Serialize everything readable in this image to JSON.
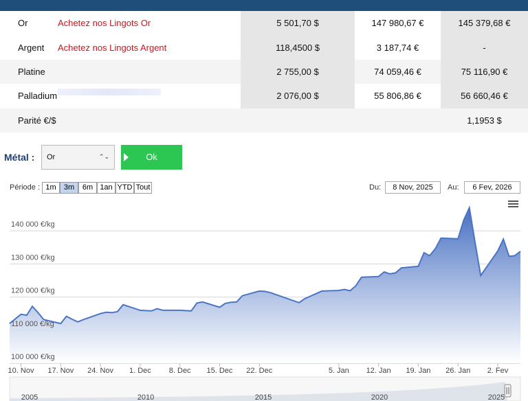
{
  "table": {
    "rows": [
      {
        "metal": "Or",
        "buy": "Achetez nos Lingots Or",
        "usd": "5 501,70 $",
        "eur_kg": "147 980,67 €",
        "eur_kg2": "145 379,68 €"
      },
      {
        "metal": "Argent",
        "buy": "Achetez nos Lingots Argent",
        "usd": "118,4500 $",
        "eur_kg": "3 187,74 €",
        "eur_kg2": "-"
      },
      {
        "metal": "Platine",
        "buy": "",
        "usd": "2 755,00 $",
        "eur_kg": "74 059,46 €",
        "eur_kg2": "75 116,90 €"
      },
      {
        "metal": "Palladium",
        "buy": "",
        "usd": "2 076,00 $",
        "eur_kg": "55 806,86 €",
        "eur_kg2": "56 660,46 €"
      }
    ],
    "parity_label": "Parité €/$",
    "parity_value": "1,1953 $"
  },
  "controls": {
    "metal_label": "Métal :",
    "metal_selected": "Or",
    "ok_label": "Ok",
    "period_label": "Période :",
    "periods": [
      "1m",
      "3m",
      "6m",
      "1an",
      "YTD",
      "Tout"
    ],
    "period_selected": "3m",
    "from_label": "Du:",
    "from_value": "8 Nov, 2025",
    "to_label": "Au:",
    "to_value": "6 Fev, 2026"
  },
  "colors": {
    "header": "#1f4e7a",
    "buy_link": "#d0121b",
    "ok": "#2cc653",
    "series": "#4a74c4",
    "metal_label": "#1f3f78"
  },
  "chart_data": {
    "type": "area",
    "ylim": [
      100000,
      150000
    ],
    "y_ticks": [
      100000,
      110000,
      120000,
      130000,
      140000
    ],
    "y_tick_labels": [
      "100 000 €/kg",
      "110 000 €/kg",
      "120 000 €/kg",
      "130 000 €/kg",
      "140 000 €/kg"
    ],
    "x_range": [
      "2025-11-08",
      "2026-02-06"
    ],
    "x_ticks": [
      "2025-11-10",
      "2025-11-17",
      "2025-11-24",
      "2025-12-01",
      "2025-12-08",
      "2025-12-15",
      "2025-12-22",
      "2026-01-05",
      "2026-01-12",
      "2026-01-19",
      "2026-01-26",
      "2026-02-02"
    ],
    "x_tick_labels": [
      "10. Nov",
      "17. Nov",
      "24. Nov",
      "1. Dec",
      "8. Dec",
      "15. Dec",
      "22. Dec",
      "5. Jan",
      "12. Jan",
      "19. Jan",
      "26. Jan",
      "2. Fev"
    ],
    "x": [
      "2025-11-08",
      "2025-11-10",
      "2025-11-11",
      "2025-11-12",
      "2025-11-13",
      "2025-11-14",
      "2025-11-17",
      "2025-11-18",
      "2025-11-19",
      "2025-11-20",
      "2025-11-21",
      "2025-11-24",
      "2025-11-25",
      "2025-11-26",
      "2025-11-27",
      "2025-11-28",
      "2025-12-01",
      "2025-12-02",
      "2025-12-03",
      "2025-12-04",
      "2025-12-05",
      "2025-12-08",
      "2025-12-09",
      "2025-12-10",
      "2025-12-11",
      "2025-12-12",
      "2025-12-15",
      "2025-12-16",
      "2025-12-17",
      "2025-12-18",
      "2025-12-19",
      "2025-12-22",
      "2025-12-23",
      "2025-12-24",
      "2025-12-29",
      "2025-12-30",
      "2026-01-02",
      "2026-01-05",
      "2026-01-06",
      "2026-01-07",
      "2026-01-08",
      "2026-01-09",
      "2026-01-12",
      "2026-01-13",
      "2026-01-14",
      "2026-01-15",
      "2026-01-16",
      "2026-01-19",
      "2026-01-20",
      "2026-01-21",
      "2026-01-22",
      "2026-01-23",
      "2026-01-26",
      "2026-01-27",
      "2026-01-28",
      "2026-01-29",
      "2026-01-30",
      "2026-02-02",
      "2026-02-03",
      "2026-02-04",
      "2026-02-05",
      "2026-02-06"
    ],
    "values": [
      112000,
      114800,
      114500,
      117200,
      115300,
      113200,
      112000,
      114200,
      113300,
      112500,
      113200,
      115000,
      115400,
      115300,
      115600,
      117700,
      116000,
      115900,
      115800,
      116500,
      116000,
      116000,
      115900,
      115800,
      118200,
      118500,
      116900,
      118100,
      118400,
      118500,
      120400,
      121800,
      121700,
      121300,
      118300,
      119500,
      121800,
      122000,
      122300,
      121900,
      123400,
      126000,
      126200,
      127600,
      127000,
      127300,
      128800,
      129300,
      133400,
      132500,
      134600,
      137800,
      137600,
      143200,
      147000,
      136500,
      126500,
      133900,
      137500,
      132300,
      132500,
      133800
    ]
  },
  "navigator": {
    "labels": [
      "2005",
      "2010",
      "2015",
      "2020",
      "2025"
    ]
  }
}
